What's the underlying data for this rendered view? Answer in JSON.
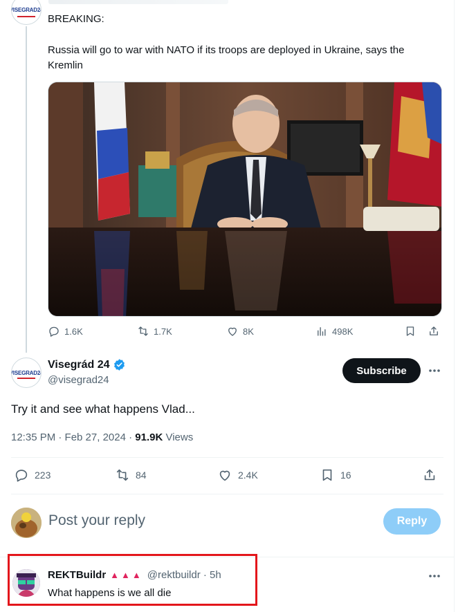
{
  "parent_tweet": {
    "avatar_logo": "VISEGRAD24",
    "heading": "BREAKING:",
    "text": "Russia will go to war with NATO if its troops are deployed in Ukraine, says the Kremlin",
    "stats": {
      "replies": "1.6K",
      "retweets": "1.7K",
      "likes": "8K",
      "views": "498K"
    }
  },
  "main_tweet": {
    "avatar_logo": "VISEGRAD24",
    "display_name": "Visegrád 24",
    "handle": "@visegrad24",
    "subscribe_label": "Subscribe",
    "text": "Try it and see what happens Vlad...",
    "time": "12:35 PM · Feb 27, 2024 · ",
    "views_count": "91.9K",
    "views_label": " Views",
    "stats": {
      "replies": "223",
      "retweets": "84",
      "likes": "2.4K",
      "bookmarks": "16"
    }
  },
  "composer": {
    "placeholder": "Post your reply",
    "reply_label": "Reply"
  },
  "reply": {
    "display_name": "REKTBuildr",
    "badges": "▲▲▲",
    "handle_time": "@rektbuildr · 5h",
    "text": "What happens is we all die"
  },
  "colors": {
    "accent": "#1d9bf0",
    "reply_button_disabled": "#8ecdf8",
    "highlight_box": "#e3161b",
    "muted_text": "#536471"
  }
}
